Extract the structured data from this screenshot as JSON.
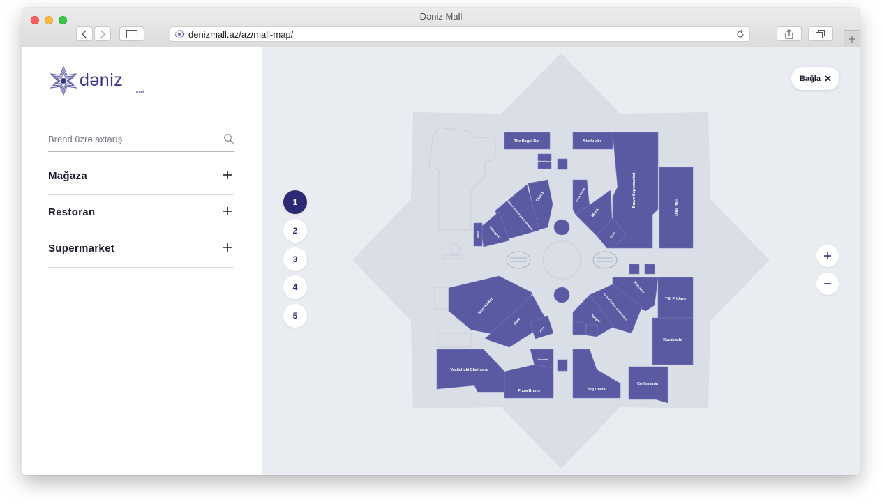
{
  "window": {
    "title": "Dəniz Mall"
  },
  "browser": {
    "url": "denizmall.az/az/mall-map/"
  },
  "brand": {
    "name": "dəniz",
    "sub": "mall"
  },
  "search": {
    "placeholder": "Brend üzrə axtarış"
  },
  "categories": [
    {
      "label": "Mağaza"
    },
    {
      "label": "Restoran"
    },
    {
      "label": "Supermarket"
    }
  ],
  "map": {
    "close_label": "Bağla",
    "floors": [
      "1",
      "2",
      "3",
      "4",
      "5"
    ],
    "active_floor": "1",
    "stores": [
      {
        "label": "The Bagel Bar"
      },
      {
        "label": "Starbucks"
      },
      {
        "label": "Ateliér Naturé"
      },
      {
        "label": "Bravo Supermarket"
      },
      {
        "label": "Dine Hall"
      },
      {
        "label": "Clarks"
      },
      {
        "label": "Golden Perfumery & Cosmetics"
      },
      {
        "label": "Swarovski"
      },
      {
        "label": "Ecco"
      },
      {
        "label": "Zara Home"
      },
      {
        "label": "Mass"
      },
      {
        "label": "Ecco"
      },
      {
        "label": "New Yorker"
      },
      {
        "label": "Nike"
      },
      {
        "label": "Levi's"
      },
      {
        "label": "Sketchers"
      },
      {
        "label": "United Colors of Benetton"
      },
      {
        "label": "Tangier"
      },
      {
        "label": "TGI Fridays"
      },
      {
        "label": "Vasilchuki Chaihona"
      },
      {
        "label": "Carousel"
      },
      {
        "label": "Pizza Brunn"
      },
      {
        "label": "Big Chefs"
      },
      {
        "label": "Coffemania"
      },
      {
        "label": "Kozabashi"
      }
    ]
  },
  "colors": {
    "store": "#5a5aa2",
    "accent": "#2d2a75",
    "map_bg": "#e9ecf1",
    "star": "#d9dee7"
  },
  "icons": {
    "search": "search-icon",
    "plus": "plus-icon",
    "close": "close-icon",
    "zoom_in": "zoom-in-icon",
    "zoom_out": "zoom-out-icon"
  }
}
